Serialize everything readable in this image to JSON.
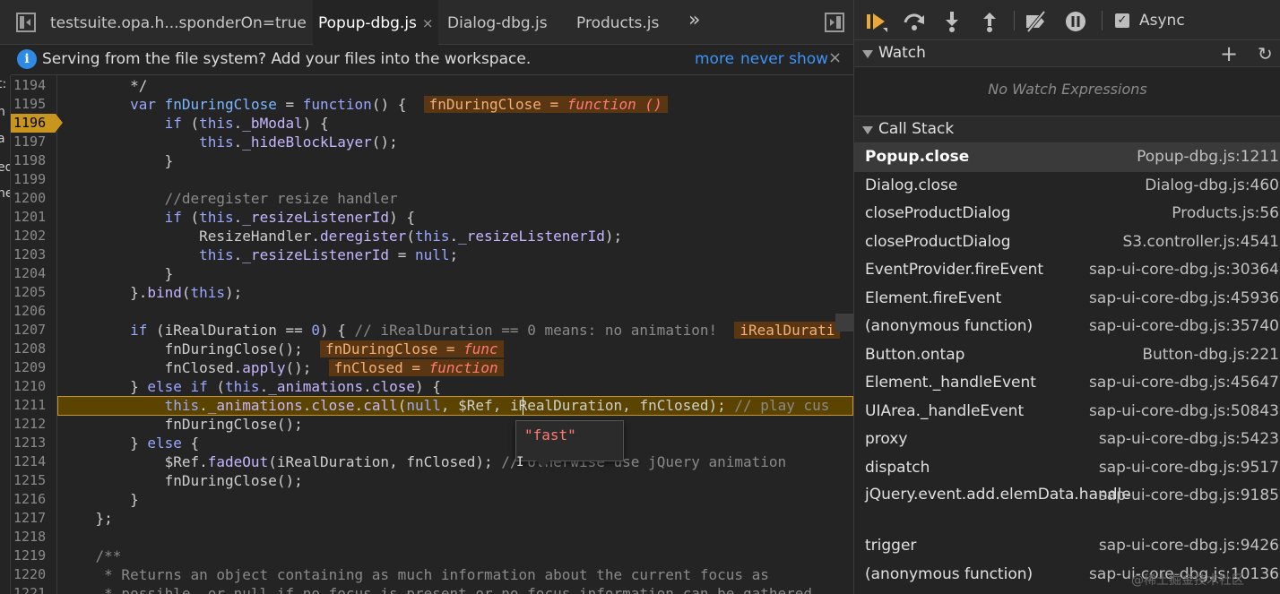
{
  "tabs": [
    {
      "label": "testsuite.opa.h...sponderOn=true",
      "active": false
    },
    {
      "label": "Popup-dbg.js",
      "active": true
    },
    {
      "label": "Dialog-dbg.js",
      "active": false
    },
    {
      "label": "Products.js",
      "active": false
    }
  ],
  "tab_close": "×",
  "tab_more": "»",
  "infobar": {
    "message": "Serving from the file system? Add your files into the workspace.",
    "more": "more",
    "never_show": "never show",
    "close": "×"
  },
  "left_strip": [
    "t:",
    "n",
    "a",
    "ed",
    "ne"
  ],
  "code": {
    "lines": [
      {
        "n": "1194",
        "html": "        */"
      },
      {
        "n": "1195",
        "html": "        <span class=\"kw\">var</span> <span class=\"fn\">fnDuringClose</span> = <span class=\"kw\">function</span>() {  <span class=\"inl\">fnDuringClose = <i>function ()</i></span>"
      },
      {
        "n": "1196",
        "html": "            <span class=\"kw\">if</span> (<span class=\"kw\">this</span>.<span class=\"pr\">_bModal</span>) {"
      },
      {
        "n": "1197",
        "html": "                <span class=\"kw\">this</span>.<span class=\"pr\">_hideBlockLayer</span>();"
      },
      {
        "n": "1198",
        "html": "            }"
      },
      {
        "n": "1199",
        "html": ""
      },
      {
        "n": "1200",
        "html": "            <span class=\"cm\">//deregister resize handler</span>"
      },
      {
        "n": "1201",
        "html": "            <span class=\"kw\">if</span> (<span class=\"kw\">this</span>.<span class=\"pr\">_resizeListenerId</span>) {"
      },
      {
        "n": "1202",
        "html": "                ResizeHandler.<span class=\"pr\">deregister</span>(<span class=\"kw\">this</span>.<span class=\"pr\">_resizeListenerId</span>);"
      },
      {
        "n": "1203",
        "html": "                <span class=\"kw\">this</span>.<span class=\"pr\">_resizeListenerId</span> = <span class=\"kw\">null</span>;"
      },
      {
        "n": "1204",
        "html": "            }"
      },
      {
        "n": "1205",
        "html": "        }.<span class=\"pr\">bind</span>(<span class=\"kw\">this</span>);"
      },
      {
        "n": "1206",
        "html": ""
      },
      {
        "n": "1207",
        "html": "        <span class=\"kw\">if</span> (iRealDuration == <span class=\"nm\">0</span>) { <span class=\"cm\">// iRealDuration == 0 means: no animation!</span>  <span class=\"inl\">iRealDurati</span>"
      },
      {
        "n": "1208",
        "html": "            fnDuringClose();  <span class=\"inl\">fnDuringClose = <i>func</i></span>"
      },
      {
        "n": "1209",
        "html": "            fnClosed.<span class=\"pr\">apply</span>();  <span class=\"inl\">fnClosed = <i>function</i></span>"
      },
      {
        "n": "1210",
        "html": "        } <span class=\"kw\">else if</span> (<span class=\"kw\">this</span>.<span class=\"pr\">_animations</span>.<span class=\"pr\">close</span>) {"
      },
      {
        "n": "1211",
        "html": "            <span class=\"kw\">this</span>.<span class=\"pr\">_animations</span>.<span class=\"pr\">close</span>.<span class=\"pr\">call</span>(<span class=\"kw\">null</span>, $Ref, iRealDuration, fnClosed); <span class=\"cm\">// play cus</span>"
      },
      {
        "n": "1212",
        "html": "            fnDuringClose();"
      },
      {
        "n": "1213",
        "html": "        } <span class=\"kw\">else</span> {"
      },
      {
        "n": "1214",
        "html": "            $Ref.<span class=\"pr\">fadeOut</span>(iRealDuration, fnClosed); <span class=\"cm\">// otherwise use jQuery animation</span>"
      },
      {
        "n": "1215",
        "html": "            fnDuringClose();"
      },
      {
        "n": "1216",
        "html": "        }"
      },
      {
        "n": "1217",
        "html": "    };"
      },
      {
        "n": "1218",
        "html": ""
      },
      {
        "n": "1219",
        "html": "    <span class=\"cm\">/**</span>"
      },
      {
        "n": "1220",
        "html": "    <span class=\"cm\"> * Returns an object containing as much information about the current focus as</span>"
      },
      {
        "n": "1221",
        "html": "    <span class=\"cm\"> * possible, or null if no focus is present or no focus information can be gathered.</span>"
      }
    ],
    "breakpoint_line": "1196",
    "exec_line": "1211"
  },
  "hover": {
    "value": "\"fast\""
  },
  "debugger": {
    "async_label": "Async",
    "async_checked": true
  },
  "watch": {
    "title": "Watch",
    "add": "+",
    "refresh": "↻",
    "empty": "No Watch Expressions"
  },
  "callstack": {
    "title": "Call Stack",
    "frames": [
      {
        "name": "Popup.close",
        "loc": "Popup-dbg.js:1211",
        "selected": true
      },
      {
        "name": "Dialog.close",
        "loc": "Dialog-dbg.js:460"
      },
      {
        "name": "closeProductDialog",
        "loc": "Products.js:56"
      },
      {
        "name": "closeProductDialog",
        "loc": "S3.controller.js:4541"
      },
      {
        "name": "EventProvider.fireEvent",
        "loc": "sap-ui-core-dbg.js:30364"
      },
      {
        "name": "Element.fireEvent",
        "loc": "sap-ui-core-dbg.js:45936"
      },
      {
        "name": "(anonymous function)",
        "loc": "sap-ui-core-dbg.js:35740"
      },
      {
        "name": "Button.ontap",
        "loc": "Button-dbg.js:221"
      },
      {
        "name": "Element._handleEvent",
        "loc": "sap-ui-core-dbg.js:45647"
      },
      {
        "name": "UIArea._handleEvent",
        "loc": "sap-ui-core-dbg.js:50843"
      },
      {
        "name": "proxy",
        "loc": "sap-ui-core-dbg.js:5423"
      },
      {
        "name": "dispatch",
        "loc": "sap-ui-core-dbg.js:9517"
      },
      {
        "name": "jQuery.event.add.elemData.handle",
        "loc": "sap-ui-core-dbg.js:9185",
        "wrap": true
      },
      {
        "name": "trigger",
        "loc": "sap-ui-core-dbg.js:9426"
      },
      {
        "name": "(anonymous function)",
        "loc": "sap-ui-core-dbg.js:10136"
      }
    ]
  },
  "watermark": "@稀土掘金技术社区",
  "colors": {
    "accent": "#3d94f6",
    "breakpoint": "#c8961e",
    "exec_bg": "#5a4400",
    "pause_btn": "#e8a93a"
  }
}
